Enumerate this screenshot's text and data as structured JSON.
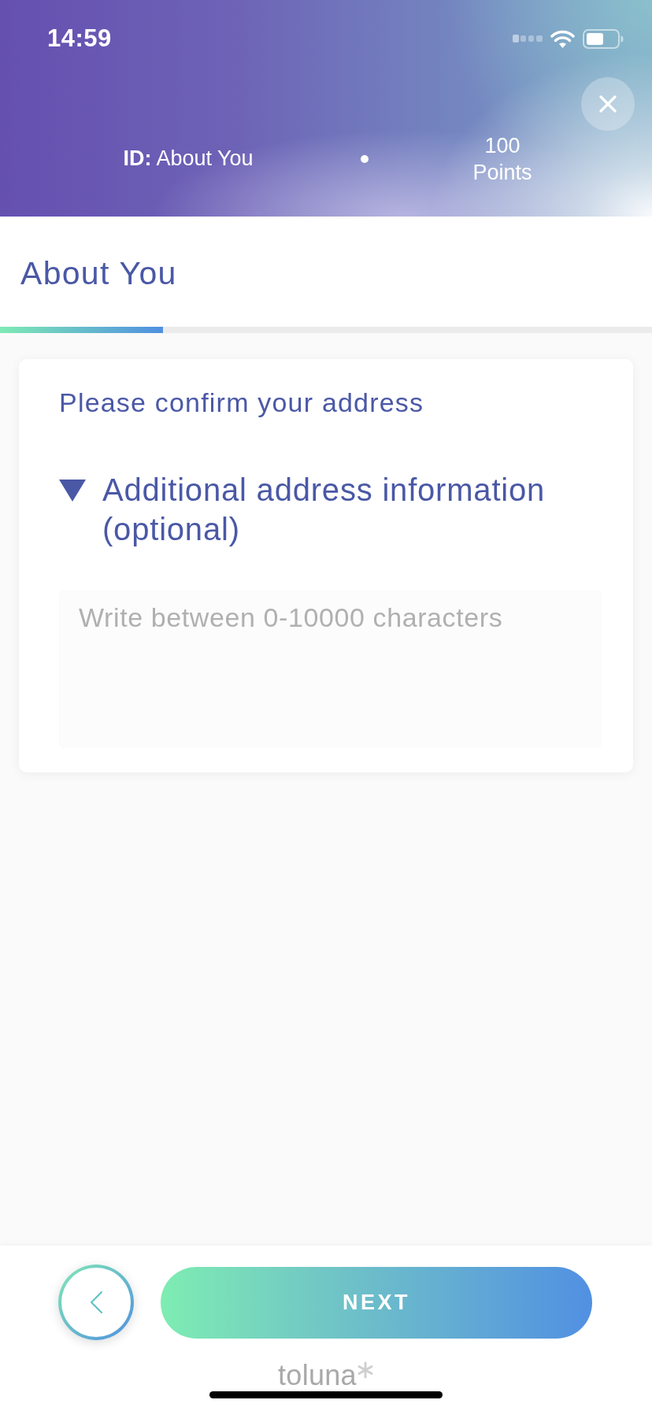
{
  "status_bar": {
    "time": "14:59"
  },
  "header": {
    "step_label": "**ID:** About You",
    "points_value": "100",
    "points_label": "Points"
  },
  "page": {
    "title": "About You",
    "progress": {
      "level": 0.25
    }
  },
  "question": {
    "prompt": "Please confirm your address",
    "section": {
      "title": "Additional address information (optional)",
      "expanded": true,
      "placeholder": "Write between 0-10000 characters"
    }
  },
  "footer": {
    "next_label": "NEXT",
    "logo": "toluna"
  }
}
